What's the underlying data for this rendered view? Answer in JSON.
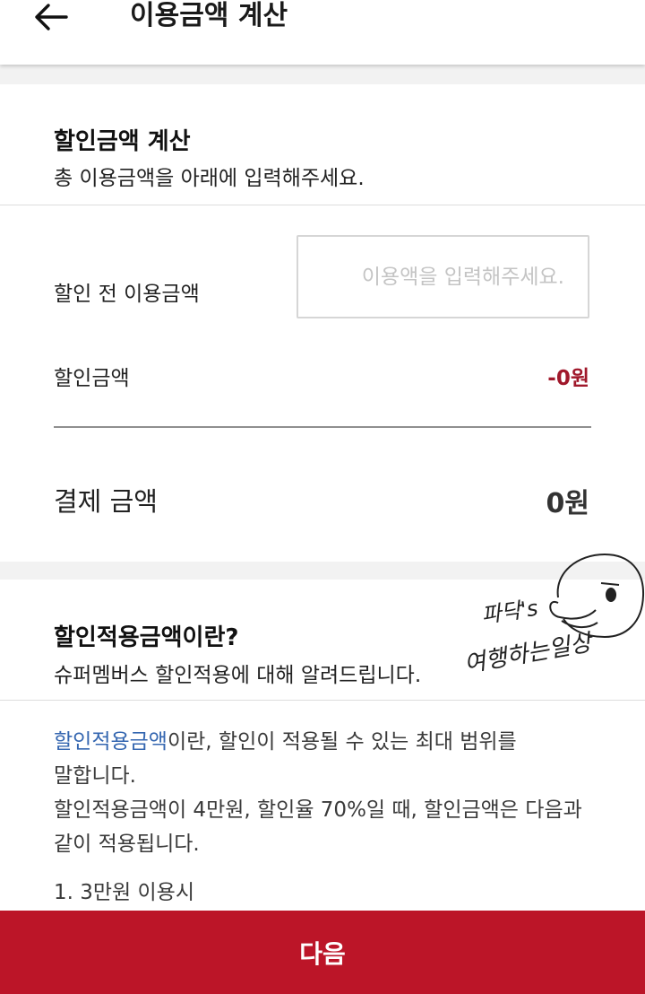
{
  "header": {
    "title": "이용금액 계산"
  },
  "calc": {
    "title": "할인금액 계산",
    "subtitle": "총 이용금액을 아래에 입력해주세요.",
    "before_label": "할인 전 이용금액",
    "input_placeholder": "이용액을 입력해주세요.",
    "discount_label": "할인금액",
    "discount_value": "-0원",
    "pay_label": "결제 금액",
    "pay_value": "0원"
  },
  "info": {
    "title": "할인적용금액이란?",
    "subtitle": "슈퍼멤버스 할인적용에 대해 알려드립니다.",
    "link_term": "할인적용금액",
    "p1_rest": "이란, 할인이 적용될 수 있는 최대 범위를",
    "p1_line2": "말합니다.",
    "p2": "할인적용금액이 4만원, 할인율 70%일 때, 할인금액은 다음과 같이 적용됩니다.",
    "item1": "1. 3만원 이용시"
  },
  "watermark": {
    "line1": "파닥's",
    "line2": "여행하는일상"
  },
  "footer": {
    "next_label": "다음"
  },
  "colors": {
    "accent": "#bc1528",
    "discount": "#a0182b",
    "link": "#3466b0"
  }
}
